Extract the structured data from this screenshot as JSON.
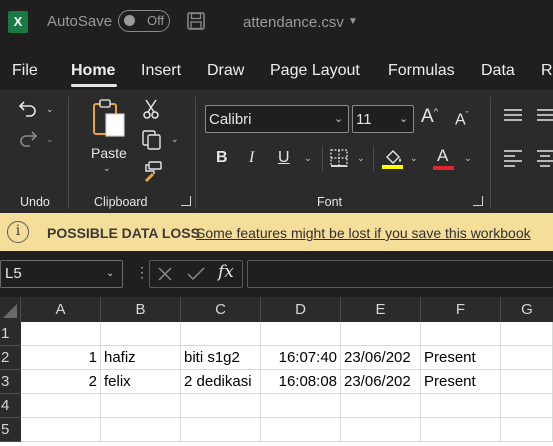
{
  "titlebar": {
    "autosave_label": "AutoSave",
    "autosave_state": "Off",
    "document_title": "attendance.csv",
    "logo_letter": "X"
  },
  "menu": {
    "tabs": [
      "File",
      "Home",
      "Insert",
      "Draw",
      "Page Layout",
      "Formulas",
      "Data",
      "Re"
    ],
    "active": "Home"
  },
  "ribbon": {
    "undo_group_label": "Undo",
    "clipboard_group_label": "Clipboard",
    "paste_label": "Paste",
    "font_group_label": "Font",
    "font_name": "Calibri",
    "font_size": "11",
    "bold": "B",
    "italic": "I",
    "underline": "U",
    "font_color_letter": "A",
    "highlight_color": "#ffff00",
    "font_color": "#e0262b"
  },
  "notification": {
    "title": "POSSIBLE DATA LOSS",
    "message": "Some features might be lost if you save this workbook"
  },
  "formula_bar": {
    "name_box": "L5",
    "fx_label": "fx",
    "formula": ""
  },
  "sheet": {
    "columns": [
      "A",
      "B",
      "C",
      "D",
      "E",
      "F",
      "G"
    ],
    "rows": [
      "1",
      "2",
      "3",
      "4",
      "5"
    ],
    "data": [
      [
        "",
        "",
        "",
        "",
        "",
        "",
        ""
      ],
      [
        "1",
        "hafiz",
        "biti s1g2",
        "16:07:40",
        "23/06/202",
        "Present",
        ""
      ],
      [
        "2",
        "felix",
        "2 dedikasi",
        "16:08:08",
        "23/06/202",
        "Present",
        ""
      ],
      [
        "",
        "",
        "",
        "",
        "",
        "",
        ""
      ],
      [
        "",
        "",
        "",
        "",
        "",
        "",
        ""
      ]
    ]
  }
}
